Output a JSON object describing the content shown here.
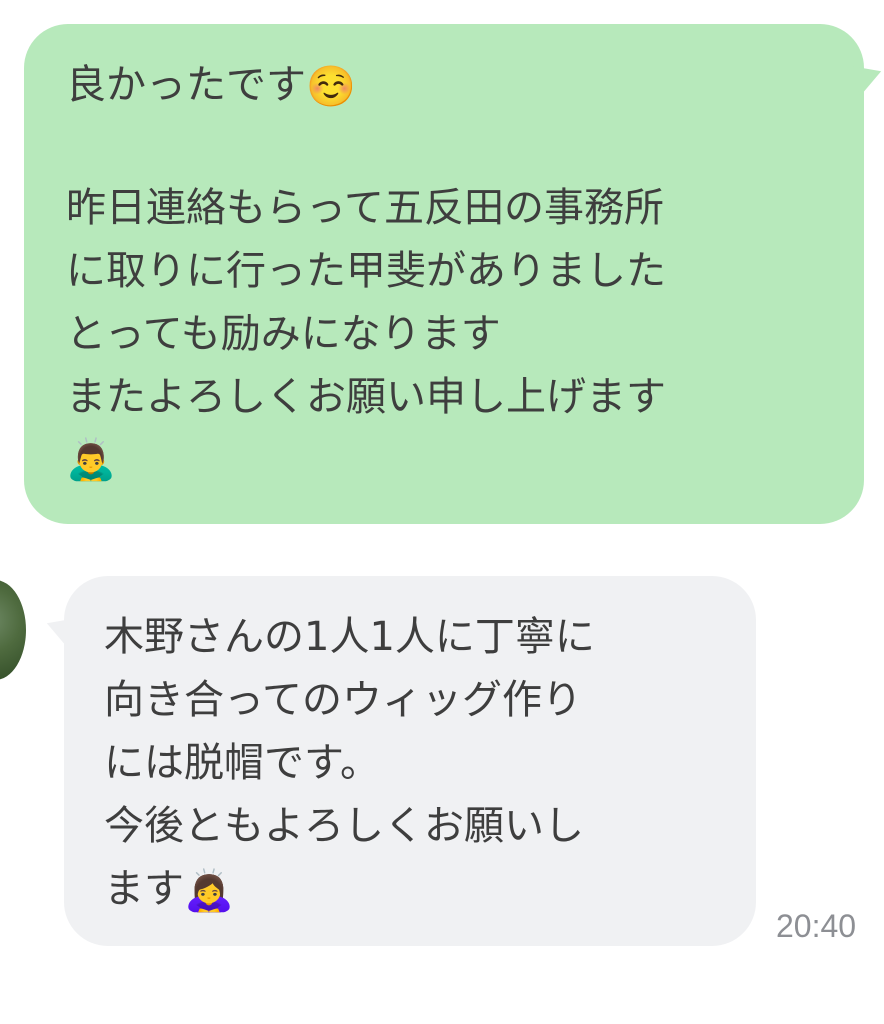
{
  "messages": {
    "outgoing": {
      "lines": [
        "良かったです",
        "",
        "昨日連絡もらって五反田の事務所",
        "に取りに行った甲斐がありました",
        "とっても励みになります",
        "またよろしくお願い申し上げます"
      ],
      "emoji_after_line1": "☺️",
      "trailing_emoji": "🙇‍♂️",
      "bubble_color": "#b7e9bb"
    },
    "incoming": {
      "lines": [
        "木野さんの1人1人に丁寧に",
        "向き合ってのウィッグ作り",
        "には脱帽です。",
        "今後ともよろしくお願いし",
        "ます"
      ],
      "trailing_emoji": "🙇‍♀️",
      "time": "20:40",
      "bubble_color": "#f0f1f3"
    }
  },
  "colors": {
    "text": "#3e3e3e",
    "timestamp": "#8d8f94",
    "background": "#ffffff"
  }
}
